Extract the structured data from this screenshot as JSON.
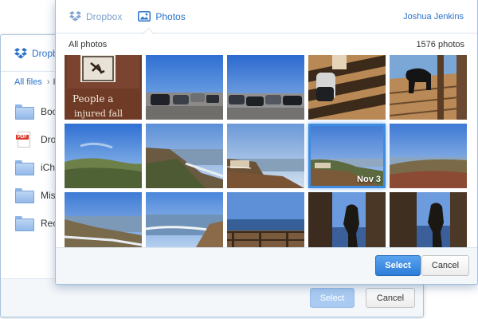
{
  "back_dialog": {
    "tab_label": "Dropbox",
    "breadcrumb": {
      "root": "All files",
      "separator": "›",
      "current": "I"
    },
    "files": [
      {
        "name": "Boo",
        "icon": "folder-icon"
      },
      {
        "name": "Dro",
        "icon": "pdf-icon"
      },
      {
        "name": "iCha",
        "icon": "folder-icon"
      },
      {
        "name": "Mis",
        "icon": "folder-icon"
      },
      {
        "name": "Rec",
        "icon": "folder-icon"
      }
    ],
    "pdf_badge": "PDF",
    "select_label": "Select",
    "cancel_label": "Cancel"
  },
  "front_dialog": {
    "tabs": [
      {
        "label": "Dropbox",
        "icon": "dropbox-icon"
      },
      {
        "label": "Photos",
        "icon": "photos-icon"
      }
    ],
    "user_name": "Joshua Jenkins",
    "section_title": "All photos",
    "photo_count": "1576 photos",
    "photos": [
      {
        "subject": "sign",
        "label": ""
      },
      {
        "subject": "parking-lot",
        "label": ""
      },
      {
        "subject": "parking-lot",
        "label": ""
      },
      {
        "subject": "deck-shadows",
        "label": ""
      },
      {
        "subject": "dog-on-deck",
        "label": ""
      },
      {
        "subject": "coast-hill",
        "label": ""
      },
      {
        "subject": "coast-cliff",
        "label": ""
      },
      {
        "subject": "coast-fence",
        "label": ""
      },
      {
        "subject": "coast-hill",
        "label": "Nov 3",
        "selected": true
      },
      {
        "subject": "coast-cliff",
        "label": ""
      },
      {
        "subject": "coast-hill",
        "label": ""
      },
      {
        "subject": "beach",
        "label": ""
      },
      {
        "subject": "beach-railing",
        "label": ""
      },
      {
        "subject": "statue",
        "label": ""
      },
      {
        "subject": "statue",
        "label": ""
      }
    ],
    "select_label": "Select",
    "cancel_label": "Cancel"
  },
  "colors": {
    "accent": "#2b72c9",
    "select_button": "#3585dd",
    "selected_outline": "#3f8de0",
    "folder": "#a8c8f0"
  }
}
